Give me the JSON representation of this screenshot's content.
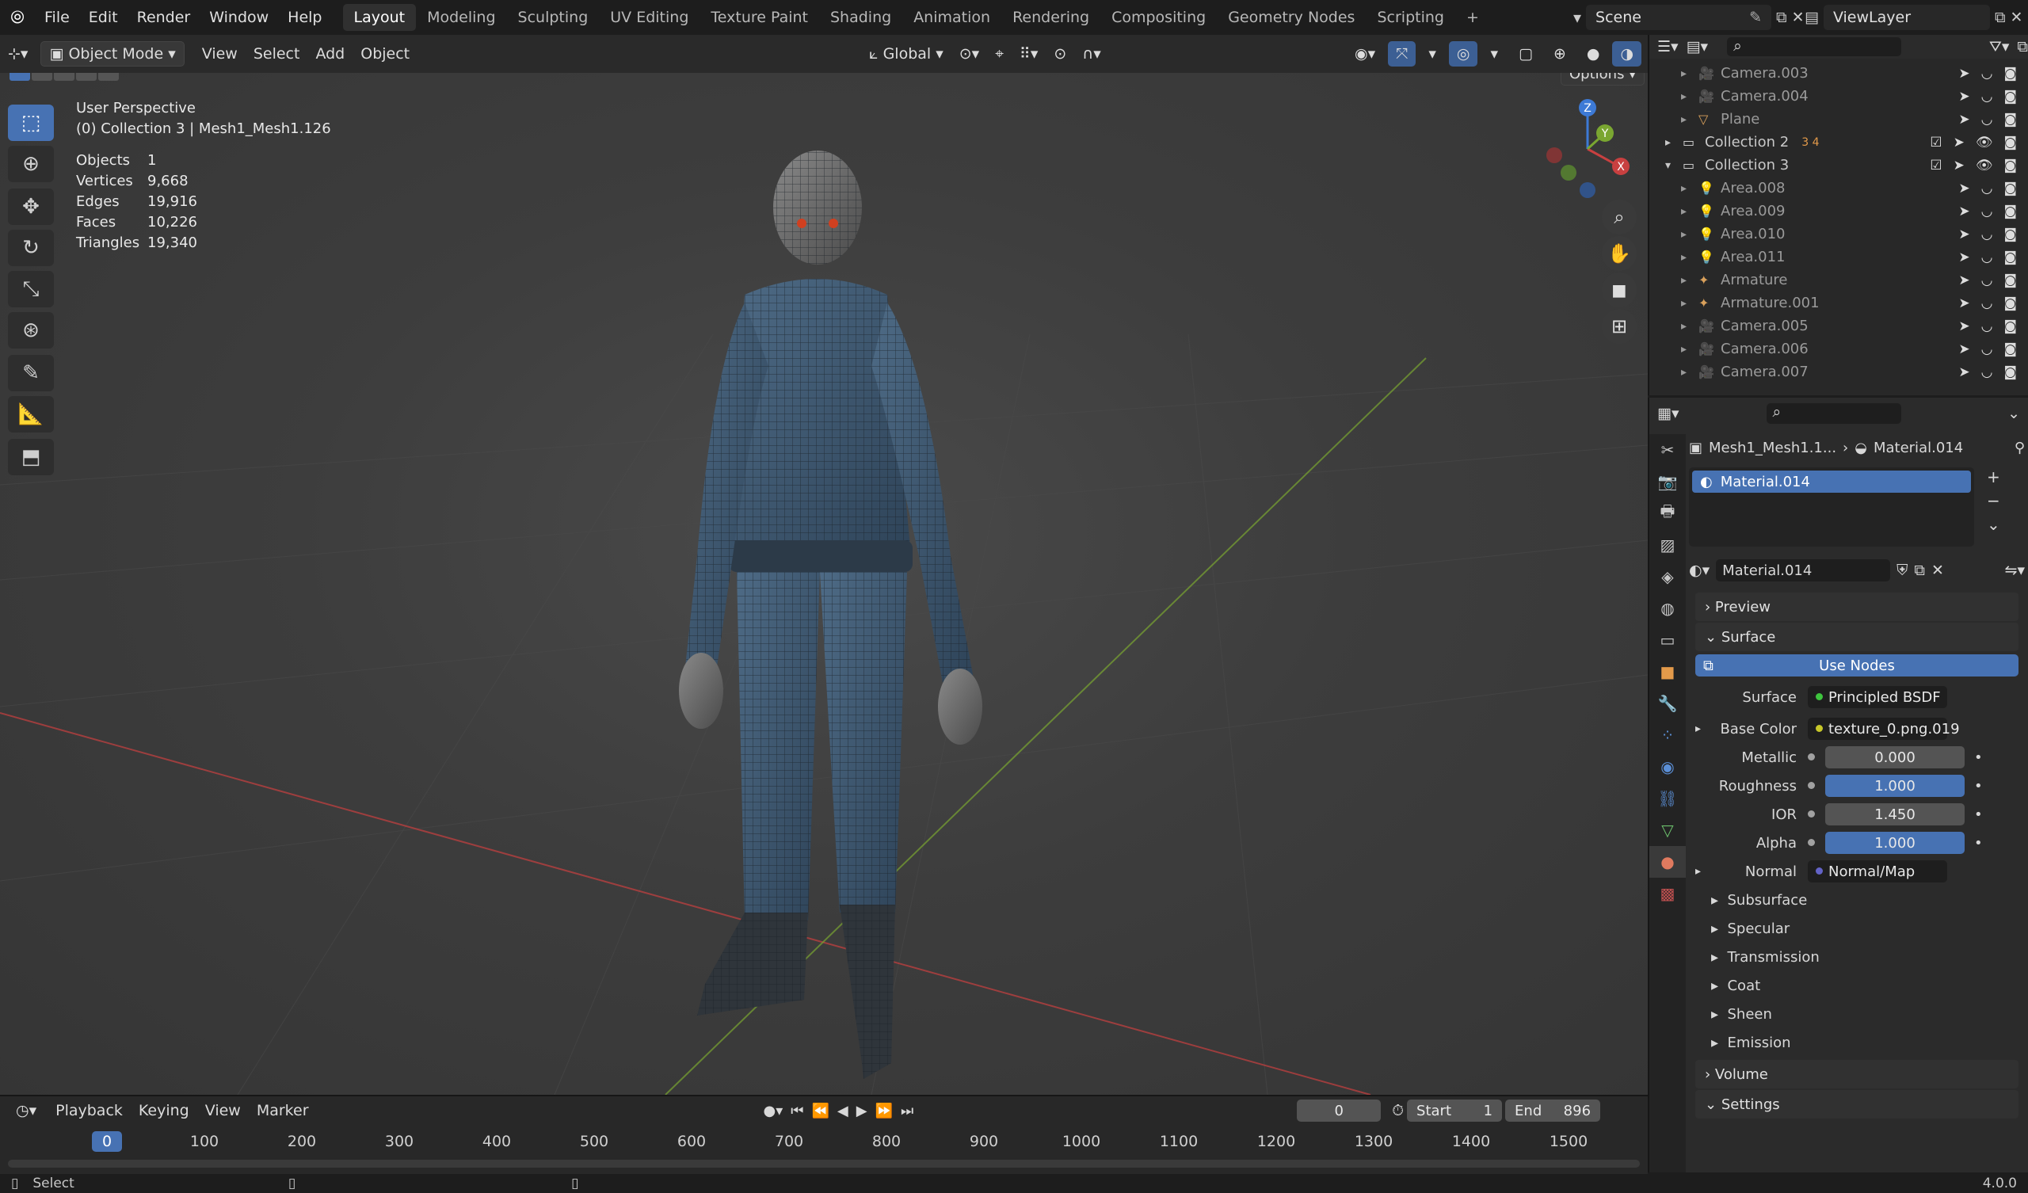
{
  "topbar": {
    "menus": [
      "File",
      "Edit",
      "Render",
      "Window",
      "Help"
    ],
    "workspaces": [
      "Layout",
      "Modeling",
      "Sculpting",
      "UV Editing",
      "Texture Paint",
      "Shading",
      "Animation",
      "Rendering",
      "Compositing",
      "Geometry Nodes",
      "Scripting"
    ],
    "active_workspace": "Layout",
    "add_tab": "+",
    "scene": "Scene",
    "view_layer": "ViewLayer"
  },
  "viewport_header": {
    "mode": "Object Mode",
    "menus": [
      "View",
      "Select",
      "Add",
      "Object"
    ],
    "transform_orientation": "Global",
    "options": "Options"
  },
  "viewport": {
    "view_name": "User Perspective",
    "collection_info": "(0) Collection 3 | Mesh1_Mesh1.126",
    "stats": [
      {
        "label": "Objects",
        "value": "1"
      },
      {
        "label": "Vertices",
        "value": "9,668"
      },
      {
        "label": "Edges",
        "value": "19,916"
      },
      {
        "label": "Faces",
        "value": "10,226"
      },
      {
        "label": "Triangles",
        "value": "19,340"
      }
    ],
    "gizmo": {
      "z": "Z",
      "y": "Y",
      "x": "X"
    }
  },
  "outliner": {
    "rows": [
      {
        "name": "Camera.003",
        "indent": 2,
        "type": "camera"
      },
      {
        "name": "Camera.004",
        "indent": 2,
        "type": "camera"
      },
      {
        "name": "Plane",
        "indent": 2,
        "type": "mesh"
      },
      {
        "name": "Collection 2",
        "indent": 1,
        "type": "collection",
        "extra": "3  4"
      },
      {
        "name": "Collection 3",
        "indent": 1,
        "type": "collection",
        "expanded": true
      },
      {
        "name": "Area.008",
        "indent": 2,
        "type": "light"
      },
      {
        "name": "Area.009",
        "indent": 2,
        "type": "light"
      },
      {
        "name": "Area.010",
        "indent": 2,
        "type": "light"
      },
      {
        "name": "Area.011",
        "indent": 2,
        "type": "light"
      },
      {
        "name": "Armature",
        "indent": 2,
        "type": "armature"
      },
      {
        "name": "Armature.001",
        "indent": 2,
        "type": "armature"
      },
      {
        "name": "Camera.005",
        "indent": 2,
        "type": "camera"
      },
      {
        "name": "Camera.006",
        "indent": 2,
        "type": "camera"
      },
      {
        "name": "Camera.007",
        "indent": 2,
        "type": "camera"
      }
    ]
  },
  "properties": {
    "breadcrumb_object": "Mesh1_Mesh1.1...",
    "breadcrumb_material": "Material.014",
    "slot_name": "Material.014",
    "material_name": "Material.014",
    "panels": {
      "preview": "Preview",
      "surface": "Surface",
      "volume": "Volume",
      "settings": "Settings"
    },
    "use_nodes": "Use Nodes",
    "surface_label": "Surface",
    "surface_value": "Principled BSDF",
    "fields": [
      {
        "label": "Base Color",
        "value": "texture_0.png.019",
        "kind": "link",
        "dot": "#c7c729"
      },
      {
        "label": "Metallic",
        "value": "0.000",
        "kind": "num",
        "dot": "#a1a1a1"
      },
      {
        "label": "Roughness",
        "value": "1.000",
        "kind": "blue",
        "dot": "#a1a1a1"
      },
      {
        "label": "IOR",
        "value": "1.450",
        "kind": "num",
        "dot": "#a1a1a1"
      },
      {
        "label": "Alpha",
        "value": "1.000",
        "kind": "blue",
        "dot": "#a1a1a1"
      },
      {
        "label": "Normal",
        "value": "Normal/Map",
        "kind": "link",
        "dot": "#6363c7"
      }
    ],
    "subpanels": [
      "Subsurface",
      "Specular",
      "Transmission",
      "Coat",
      "Sheen",
      "Emission"
    ]
  },
  "timeline": {
    "menus": [
      "Playback",
      "Keying",
      "View",
      "Marker"
    ],
    "current_frame": "0",
    "start_label": "Start",
    "start": "1",
    "end_label": "End",
    "end": "896",
    "ticks": [
      "0",
      "100",
      "200",
      "300",
      "400",
      "500",
      "600",
      "700",
      "800",
      "900",
      "1000",
      "1100",
      "1200",
      "1300",
      "1400",
      "1500"
    ]
  },
  "statusbar": {
    "left": "Select",
    "version": "4.0.0"
  },
  "colors": {
    "accent": "#4772b3",
    "x_axis": "#c84040",
    "y_axis": "#7aa631"
  }
}
